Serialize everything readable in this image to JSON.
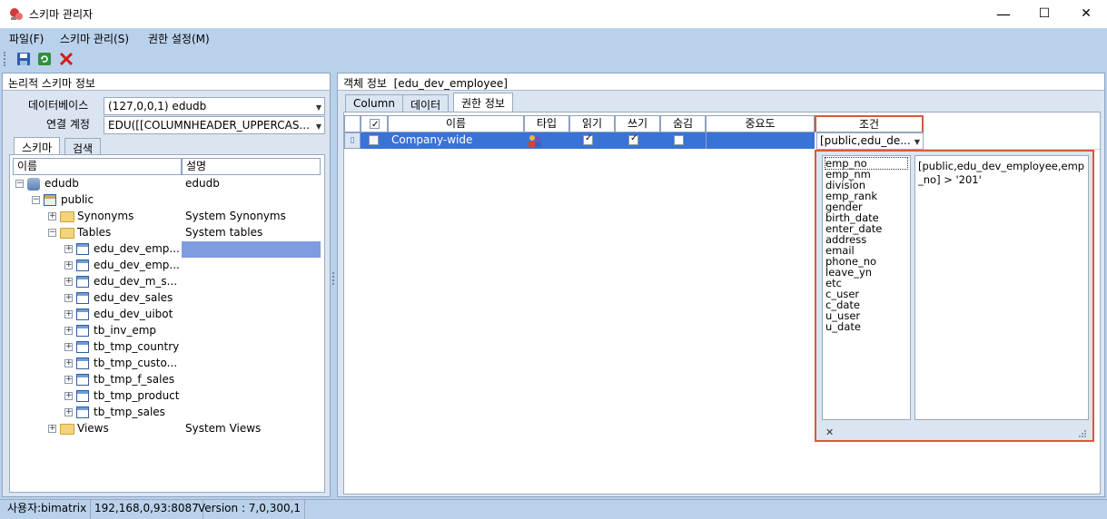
{
  "window": {
    "title": "스키마 관리자",
    "minimize": "—",
    "maximize": "☐",
    "close": "✕"
  },
  "menu": [
    "파일(F)",
    "스키마 관리(S)",
    "권한 설정(M)"
  ],
  "left_panel": {
    "header": "논리적 스키마 정보",
    "database_label": "데이터베이스",
    "database_value": "(127,0,0,1) edudb",
    "account_label": "연결 계정",
    "account_value": "EDU([[COLUMNHEADER_UPPERCAS...",
    "tabs": [
      "스키마",
      "검색"
    ],
    "tree_headers": [
      "이름",
      "설명"
    ],
    "tree": [
      {
        "name": "edudb",
        "desc": "edudb"
      },
      {
        "name": "public",
        "desc": ""
      },
      {
        "name": "Synonyms",
        "desc": "System Synonyms"
      },
      {
        "name": "Tables",
        "desc": "System tables"
      },
      {
        "name": "edu_dev_emp...",
        "desc": ""
      },
      {
        "name": "edu_dev_emp...",
        "desc": ""
      },
      {
        "name": "edu_dev_m_s...",
        "desc": ""
      },
      {
        "name": "edu_dev_sales",
        "desc": ""
      },
      {
        "name": "edu_dev_uibot",
        "desc": ""
      },
      {
        "name": "tb_inv_emp",
        "desc": ""
      },
      {
        "name": "tb_tmp_country",
        "desc": ""
      },
      {
        "name": "tb_tmp_custo...",
        "desc": ""
      },
      {
        "name": "tb_tmp_f_sales",
        "desc": ""
      },
      {
        "name": "tb_tmp_product",
        "desc": ""
      },
      {
        "name": "tb_tmp_sales",
        "desc": ""
      },
      {
        "name": "Views",
        "desc": "System Views"
      }
    ]
  },
  "right_panel": {
    "header_label": "객체 정보",
    "header_value": "[edu_dev_employee]",
    "tabs": [
      "Column",
      "데이터",
      "권한 정보"
    ],
    "grid_headers": [
      "이름",
      "타입",
      "읽기",
      "쓰기",
      "숨김",
      "중요도",
      "조건"
    ],
    "row": {
      "name": "Company-wide",
      "read": true,
      "write": true,
      "hide": false,
      "condition": "[public,edu_de..."
    },
    "popup": {
      "columns": [
        "emp_no",
        "emp_nm",
        "division",
        "emp_rank",
        "gender",
        "birth_date",
        "enter_date",
        "address",
        "email",
        "phone_no",
        "leave_yn",
        "etc",
        "c_user",
        "c_date",
        "u_user",
        "u_date"
      ],
      "expression": "[public,edu_dev_employee,emp_no] > '201'",
      "close": "✕"
    }
  },
  "status": {
    "user": "사용자:bimatrix",
    "address": "192,168,0,93:8087",
    "version": "Version : 7,0,300,1"
  }
}
